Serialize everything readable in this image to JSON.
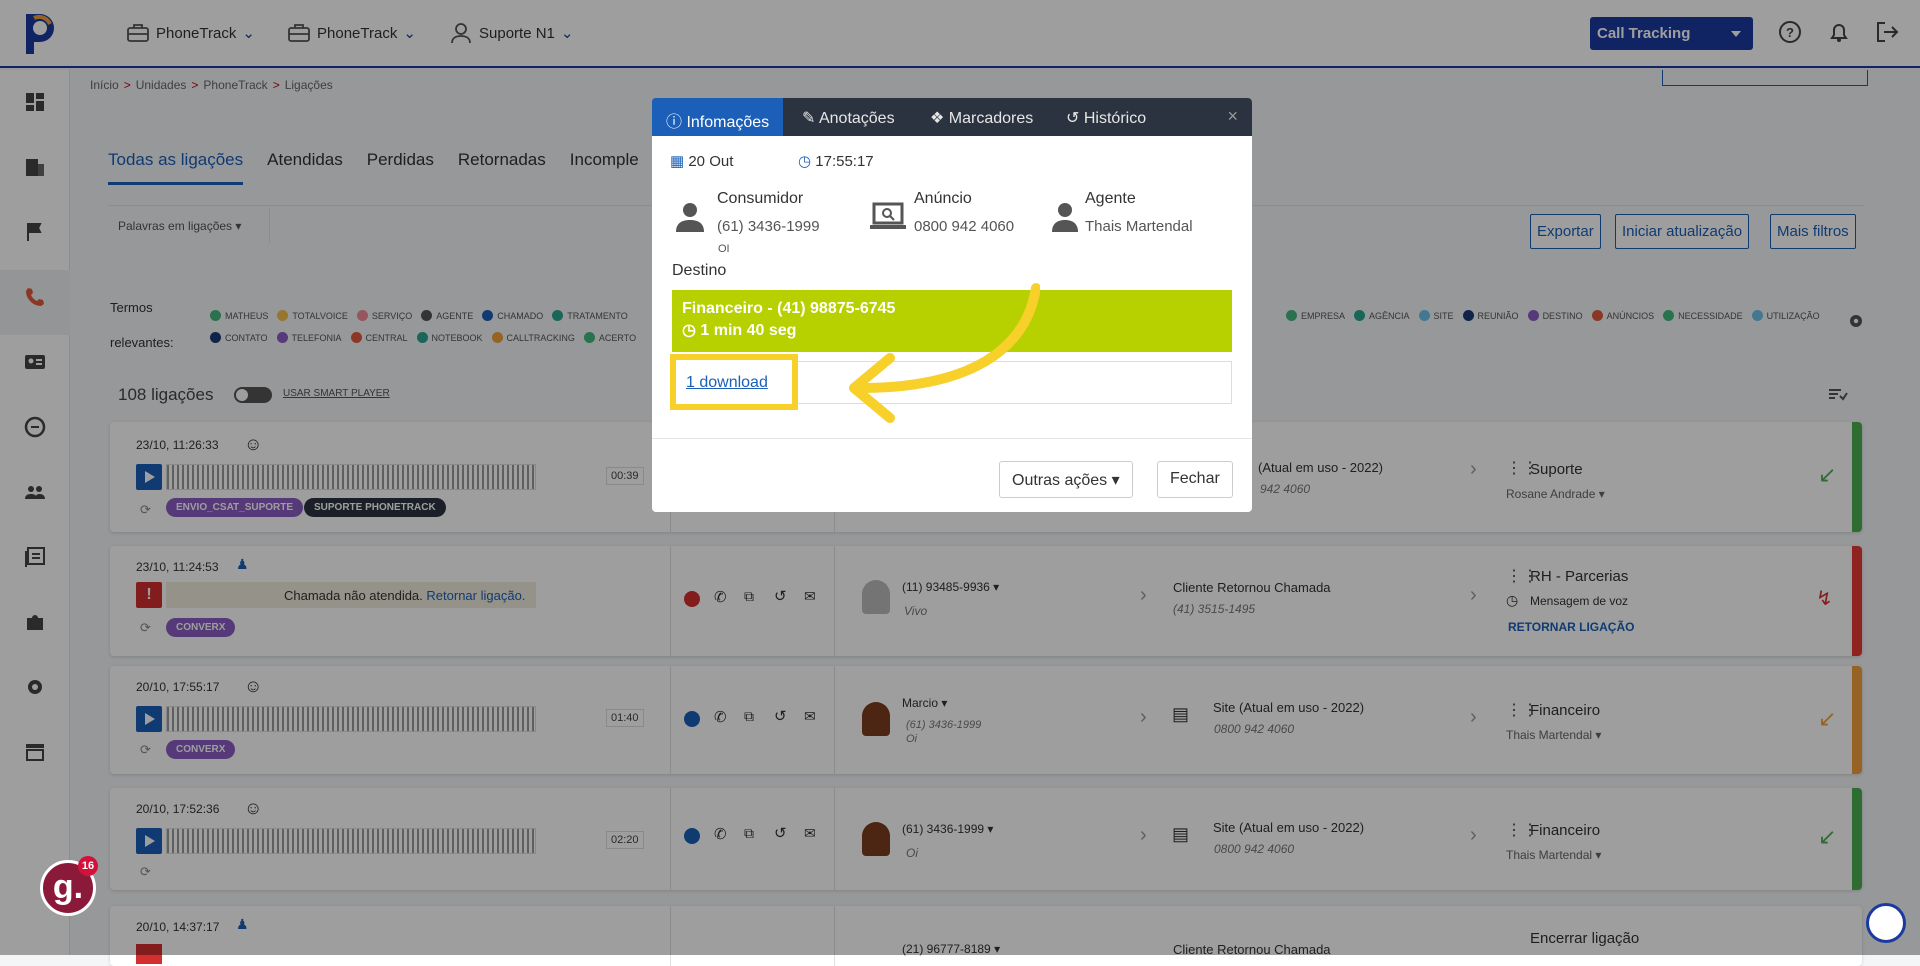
{
  "topbar": {
    "nav": [
      {
        "label": "PhoneTrack",
        "icon": "briefcase-icon"
      },
      {
        "label": "PhoneTrack",
        "icon": "briefcase-icon"
      },
      {
        "label": "Suporte N1",
        "icon": "user-icon"
      }
    ],
    "product_select": "Call Tracking"
  },
  "breadcrumb": [
    "Início",
    "Unidades",
    "PhoneTrack",
    "Ligações"
  ],
  "tabs": [
    "Todas as ligações",
    "Atendidas",
    "Perdidas",
    "Retornadas",
    "Incomple"
  ],
  "filters": {
    "keywords_placeholder": "Palavras em ligações",
    "export": "Exportar",
    "start_update": "Iniciar atualização",
    "more_filters": "Mais filtros"
  },
  "terms": {
    "label_1": "Termos",
    "label_2": "relevantes:",
    "row1": [
      {
        "name": "MATHEUS",
        "color": "#43b97f"
      },
      {
        "name": "TOTALVOICE",
        "color": "#f2c14e"
      },
      {
        "name": "SERVIÇO",
        "color": "#f28b9b"
      },
      {
        "name": "AGENTE",
        "color": "#555555"
      },
      {
        "name": "CHAMADO",
        "color": "#1b5fb8"
      },
      {
        "name": "TRATAMENTO",
        "color": "#2aa58f"
      }
    ],
    "row1_right": [
      {
        "name": "EMPRESA",
        "color": "#43b97f"
      },
      {
        "name": "AGÊNCIA",
        "color": "#2aa58f"
      },
      {
        "name": "SITE",
        "color": "#6cc3e8"
      },
      {
        "name": "REUNIÃO",
        "color": "#1b3a7a"
      },
      {
        "name": "DESTINO",
        "color": "#8a5cc4"
      },
      {
        "name": "ANÚNCIOS",
        "color": "#e05a3c"
      },
      {
        "name": "NECESSIDADE",
        "color": "#43b97f"
      },
      {
        "name": "UTILIZAÇÃO",
        "color": "#6cc3e8"
      }
    ],
    "row2": [
      {
        "name": "CONTATO",
        "color": "#1b3a7a"
      },
      {
        "name": "TELEFONIA",
        "color": "#8a5cc4"
      },
      {
        "name": "CENTRAL",
        "color": "#e05a3c"
      },
      {
        "name": "NOTEBOOK",
        "color": "#2aa58f"
      },
      {
        "name": "CALLTRACKING",
        "color": "#f2a13c"
      },
      {
        "name": "ACERTO",
        "color": "#43b97f"
      }
    ]
  },
  "list": {
    "count": "108 ligações",
    "smart_player": "USAR SMART PLAYER"
  },
  "calls": [
    {
      "date": "23/10, 11:26:33",
      "duration": "00:39",
      "tags": [
        "ENVIO_CSAT_SUPORTE",
        "SUPORTE PHONETRACK"
      ],
      "source": "(Atual em uso - 2022)",
      "source_phone": "942 4060",
      "dest": "Suporte",
      "agent": "Rosane Andrade",
      "bar": "#4caf50"
    },
    {
      "date": "23/10, 11:24:53",
      "missed_text": "Chamada não atendida.",
      "missed_link": "Retornar ligação.",
      "tags": [
        "CONVERX"
      ],
      "caller": "(11) 93485-9936",
      "carrier": "Vivo",
      "source": "Cliente Retornou Chamada",
      "source_phone": "(41) 3515-1495",
      "dest": "RH - Parcerias",
      "dest_sub": "Mensagem de voz",
      "action": "RETORNAR LIGAÇÃO",
      "bar": "#e53935"
    },
    {
      "date": "20/10, 17:55:17",
      "duration": "01:40",
      "tags": [
        "CONVERX"
      ],
      "caller": "Marcio",
      "caller_phone": "(61) 3436-1999",
      "carrier": "Oi",
      "source": "Site (Atual em uso - 2022)",
      "source_phone": "0800 942 4060",
      "dest": "Financeiro",
      "agent": "Thais Martendal",
      "bar": "#f2a13c"
    },
    {
      "date": "20/10, 17:52:36",
      "duration": "02:20",
      "caller": "(61) 3436-1999",
      "carrier": "Oi",
      "source": "Site (Atual em uso - 2022)",
      "source_phone": "0800 942 4060",
      "dest": "Financeiro",
      "agent": "Thais Martendal",
      "bar": "#4caf50"
    },
    {
      "date": "20/10, 14:37:17",
      "caller": "(21) 96777-8189",
      "source": "Cliente Retornou Chamada",
      "dest": "Encerrar ligação"
    }
  ],
  "modal": {
    "tabs": [
      "Infomações",
      "Anotações",
      "Marcadores",
      "Histórico"
    ],
    "date": "20 Out",
    "time": "17:55:17",
    "consumer_label": "Consumidor",
    "consumer_phone": "(61) 3436-1999",
    "consumer_carrier": "OI",
    "ad_label": "Anúncio",
    "ad_phone": "0800 942 4060",
    "agent_label": "Agente",
    "agent_name": "Thais Martendal",
    "dest_label": "Destino",
    "dest_line": "Financeiro - (41) 98875-6745",
    "dest_duration": "1 min 40 seg",
    "download": "1 download",
    "other_actions": "Outras ações",
    "close": "Fechar"
  },
  "guide_badge": {
    "letter": "g.",
    "count": "16"
  }
}
